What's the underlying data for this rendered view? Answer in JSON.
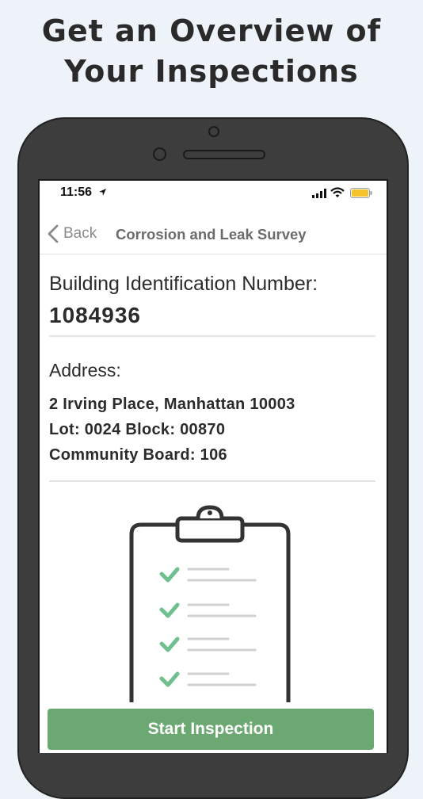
{
  "headline": {
    "line1": "Get an Overview of",
    "line2": "Your Inspections"
  },
  "status_bar": {
    "time": "11:56",
    "icons": [
      "location-arrow-icon",
      "cellular-signal-icon",
      "wifi-icon",
      "battery-icon"
    ],
    "battery_color": "#f5c32c"
  },
  "nav": {
    "back_label": "Back",
    "title": "Corrosion and Leak Survey"
  },
  "building": {
    "bin_label": "Building Identification Number:",
    "bin_value": "1084936"
  },
  "address": {
    "label": "Address:",
    "line1": "2 Irving Place, Manhattan 10003",
    "line2": "Lot: 0024 Block: 00870",
    "line3": "Community Board: 106"
  },
  "illustration": {
    "icon": "clipboard-checklist-icon",
    "check_color": "#6fbf8f"
  },
  "actions": {
    "start_label": "Start Inspection",
    "button_color": "#6ca872"
  }
}
